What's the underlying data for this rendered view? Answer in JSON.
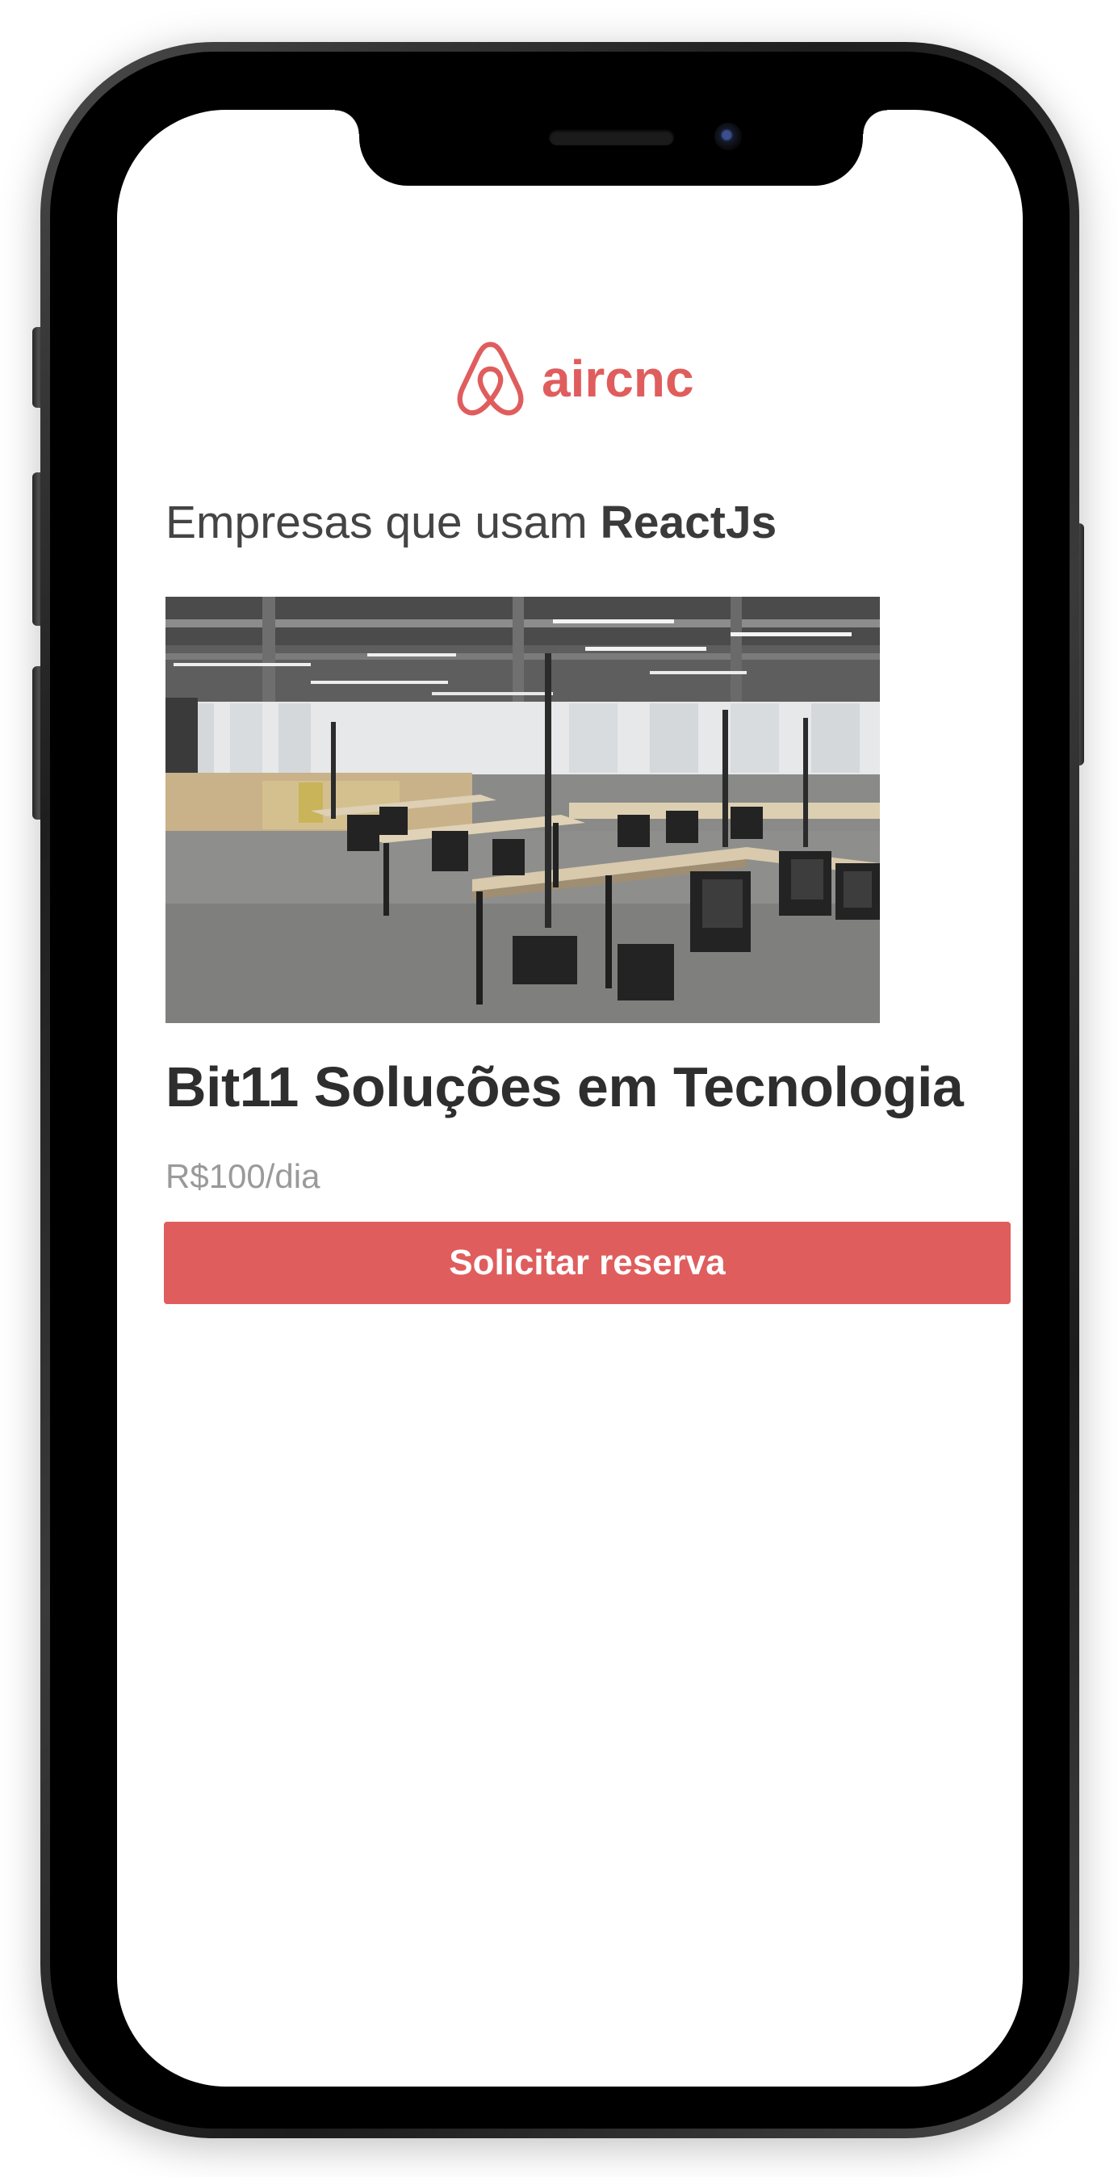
{
  "app": {
    "logo_text": "aircnc",
    "brand_color": "#E05D5D"
  },
  "list": {
    "heading_prefix": "Empresas que usam ",
    "heading_tech": "ReactJs"
  },
  "spot": {
    "image_icon": "coworking-office-photo",
    "company": "Bit11 Soluções em Tecnologia",
    "price": "R$100/dia",
    "button_label": "Solicitar reserva"
  },
  "colors": {
    "heading_text": "#444444",
    "title_text": "#2e2e2e",
    "price_text": "#9a9a9a",
    "button_text": "#ffffff"
  }
}
